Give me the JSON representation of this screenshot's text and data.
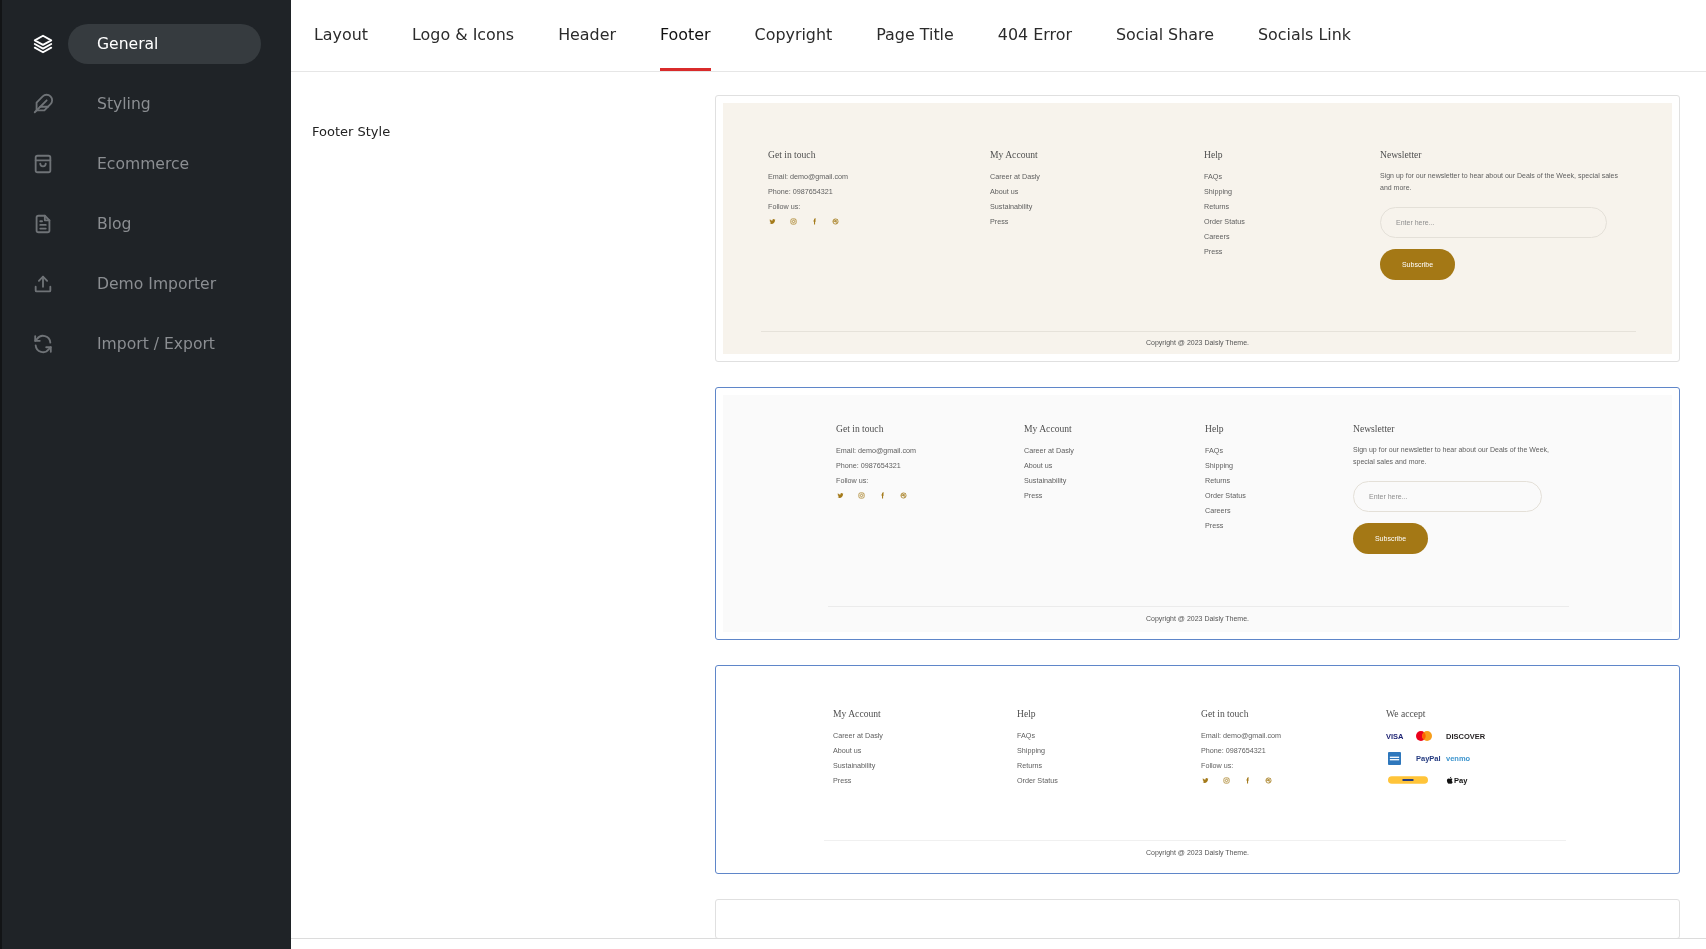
{
  "sidebar": {
    "items": [
      {
        "label": "General",
        "selected": true
      },
      {
        "label": "Styling",
        "selected": false
      },
      {
        "label": "Ecommerce",
        "selected": false
      },
      {
        "label": "Blog",
        "selected": false
      },
      {
        "label": "Demo Importer",
        "selected": false
      },
      {
        "label": "Import / Export",
        "selected": false
      }
    ]
  },
  "tabs": [
    {
      "label": "Layout",
      "selected": false
    },
    {
      "label": "Logo & Icons",
      "selected": false
    },
    {
      "label": "Header",
      "selected": false
    },
    {
      "label": "Footer",
      "selected": true
    },
    {
      "label": "Copyright",
      "selected": false
    },
    {
      "label": "Page Title",
      "selected": false
    },
    {
      "label": "404 Error",
      "selected": false
    },
    {
      "label": "Social Share",
      "selected": false
    },
    {
      "label": "Socials Link",
      "selected": false
    }
  ],
  "footer_style": {
    "label": "Footer Style",
    "options": [
      {
        "kind": "wide",
        "selected": false,
        "color": "#f7f3ec",
        "columns": [
          {
            "kind": "contact",
            "heading": "Get in touch",
            "lines": [
              "Email: demo@gmail.com",
              "Phone: 0987654321",
              "Follow us:"
            ]
          },
          {
            "kind": "links",
            "heading": "My Account",
            "items": [
              "Career at Dasly",
              "About us",
              "Sustainability",
              "Press"
            ]
          },
          {
            "kind": "links",
            "heading": "Help",
            "items": [
              "FAQs",
              "Shipping",
              "Returns",
              "Order Status",
              "Careers",
              "Press"
            ]
          },
          {
            "kind": "newsletter",
            "heading": "Newsletter",
            "text": "Sign up for our newsletter to hear about our Deals of the Week, special sales and more.",
            "placeholder": "Enter here...",
            "button": "Subscribe"
          }
        ],
        "copyright": "Copyright @ 2023 Daisly Theme."
      },
      {
        "kind": "boxed",
        "selected": true,
        "color": "#fafafa",
        "columns": [
          {
            "kind": "contact",
            "heading": "Get in touch",
            "lines": [
              "Email: demo@gmail.com",
              "Phone: 0987654321",
              "Follow us:"
            ]
          },
          {
            "kind": "links",
            "heading": "My Account",
            "items": [
              "Career at Dasly",
              "About us",
              "Sustainability",
              "Press"
            ]
          },
          {
            "kind": "links",
            "heading": "Help",
            "items": [
              "FAQs",
              "Shipping",
              "Returns",
              "Order Status",
              "Careers",
              "Press"
            ]
          },
          {
            "kind": "newsletter",
            "heading": "Newsletter",
            "text": "Sign up for our newsletter to hear about our Deals of the Week, special sales and more.",
            "placeholder": "Enter here...",
            "button": "Subscribe"
          }
        ],
        "copyright": "Copyright @ 2023 Daisly Theme."
      },
      {
        "kind": "even",
        "selected": true,
        "color": "#ffffff",
        "columns": [
          {
            "kind": "links",
            "heading": "My Account",
            "items": [
              "Career at Dasly",
              "About us",
              "Sustainability",
              "Press"
            ]
          },
          {
            "kind": "links",
            "heading": "Help",
            "items": [
              "FAQs",
              "Shipping",
              "Returns",
              "Order Status"
            ]
          },
          {
            "kind": "contact",
            "heading": "Get in touch",
            "lines": [
              "Email: demo@gmail.com",
              "Phone: 0987654321",
              "Follow us:"
            ]
          },
          {
            "kind": "payments",
            "heading": "We accept",
            "rows": [
              [
                {
                  "kind": "wordmark",
                  "text": "VISA",
                  "color": "#1a1f71"
                },
                {
                  "kind": "circles"
                },
                {
                  "kind": "wordmark",
                  "text": "DISCOVER",
                  "color": "#231f20"
                }
              ],
              [
                {
                  "kind": "tile"
                },
                {
                  "kind": "wordmark",
                  "text": "PayPal",
                  "color": "#253b80"
                },
                {
                  "kind": "wordmark",
                  "text": "venmo",
                  "color": "#3d95ce"
                }
              ],
              [
                {
                  "kind": "pill"
                },
                "",
                {
                  "kind": "apple",
                  "text": "Pay"
                }
              ]
            ]
          }
        ],
        "copyright": "Copyright @ 2023 Daisly Theme."
      },
      {
        "selected": false
      }
    ]
  }
}
